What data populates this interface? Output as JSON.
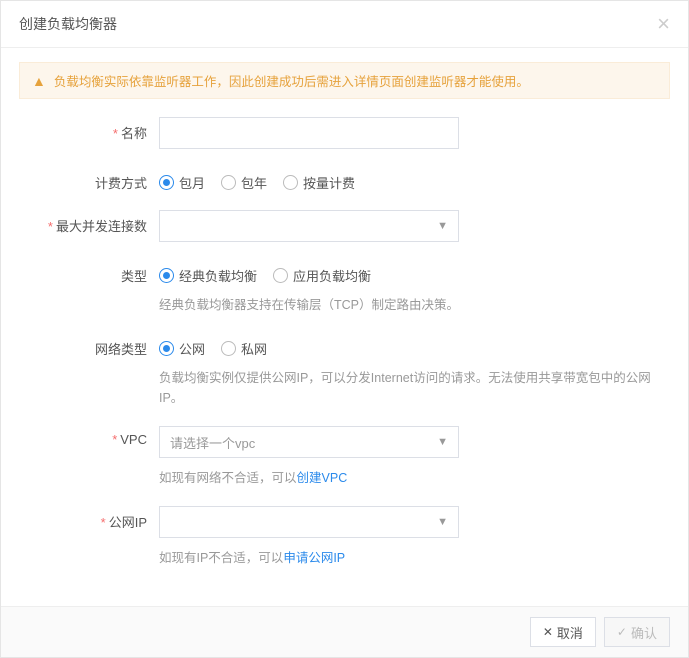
{
  "dialog": {
    "title": "创建负载均衡器",
    "alert": "负载均衡实际依靠监听器工作，因此创建成功后需进入详情页面创建监听器才能使用。"
  },
  "form": {
    "name": {
      "label": "名称",
      "value": ""
    },
    "billing": {
      "label": "计费方式",
      "options": [
        "包月",
        "包年",
        "按量计费"
      ]
    },
    "maxConn": {
      "label": "最大并发连接数",
      "value": ""
    },
    "type": {
      "label": "类型",
      "options": [
        "经典负载均衡",
        "应用负载均衡"
      ],
      "help": "经典负载均衡器支持在传输层（TCP）制定路由决策。"
    },
    "netType": {
      "label": "网络类型",
      "options": [
        "公网",
        "私网"
      ],
      "help": "负载均衡实例仅提供公网IP，可以分发Internet访问的请求。无法使用共享带宽包中的公网IP。"
    },
    "vpc": {
      "label": "VPC",
      "placeholder": "请选择一个vpc",
      "helpPrefix": "如现有网络不合适，可以",
      "helpLink": "创建VPC"
    },
    "publicIp": {
      "label": "公网IP",
      "value": "",
      "helpPrefix": "如现有IP不合适，可以",
      "helpLink": "申请公网IP"
    }
  },
  "footer": {
    "cancel": "取消",
    "confirm": "确认"
  }
}
